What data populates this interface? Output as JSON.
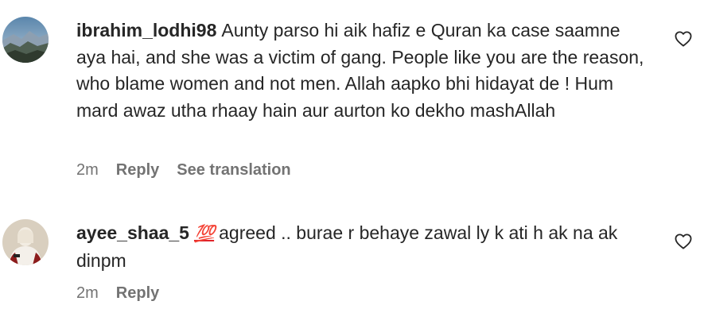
{
  "comments": [
    {
      "username": "ibrahim_lodhi98",
      "emoji": "",
      "text": "Aunty parso hi aik hafiz e Quran ka case saamne aya hai, and she was a victim of gang. People like you are the reason, who blame women and not men. Allah aapko bhi hidayat de ! Hum mard awaz utha rhaay hain aur aurton ko dekho mashAllah",
      "time": "2m",
      "reply_label": "Reply",
      "translate_label": "See translation",
      "avatar_icon": "mountain-landscape-avatar",
      "like_icon": "heart-outline-icon"
    },
    {
      "username": "ayee_shaa_5",
      "emoji": "💯",
      "text": "agreed .. burae r behaye zawal ly k ati h ak na ak dinpm",
      "time": "2m",
      "reply_label": "Reply",
      "avatar_icon": "person-avatar",
      "like_icon": "heart-outline-icon"
    }
  ],
  "colors": {
    "text": "#262626",
    "meta": "#737373",
    "emoji_red": "#e0242a"
  }
}
